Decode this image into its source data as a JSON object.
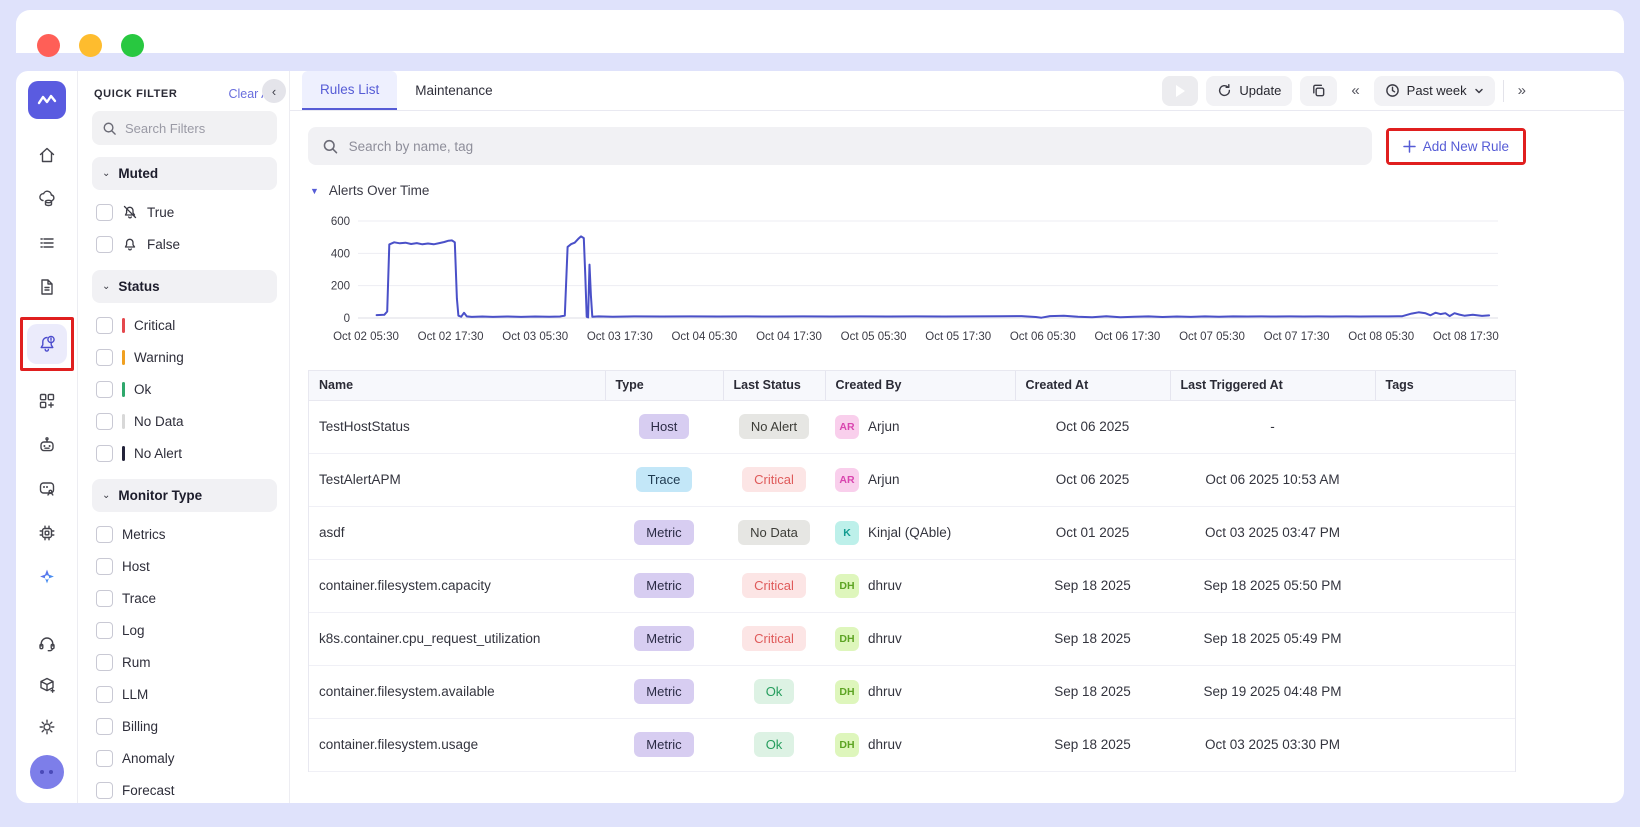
{
  "filter_panel": {
    "title": "QUICK FILTER",
    "clear_all_label": "Clear All",
    "search_placeholder": "Search Filters",
    "sections": [
      {
        "id": "muted",
        "label": "Muted",
        "items": [
          {
            "label": "True",
            "icon": "bell-slash"
          },
          {
            "label": "False",
            "icon": "bell"
          }
        ]
      },
      {
        "id": "status",
        "label": "Status",
        "items": [
          {
            "label": "Critical",
            "bar": "#e5484d"
          },
          {
            "label": "Warning",
            "bar": "#f0a020"
          },
          {
            "label": "Ok",
            "bar": "#2fa86c"
          },
          {
            "label": "No Data",
            "bar": "#d8d8d8"
          },
          {
            "label": "No Alert",
            "bar": "#23233a"
          }
        ]
      },
      {
        "id": "monitor-type",
        "label": "Monitor Type",
        "items": [
          {
            "label": "Metrics"
          },
          {
            "label": "Host"
          },
          {
            "label": "Trace"
          },
          {
            "label": "Log"
          },
          {
            "label": "Rum"
          },
          {
            "label": "LLM"
          },
          {
            "label": "Billing"
          },
          {
            "label": "Anomaly"
          },
          {
            "label": "Forecast"
          }
        ]
      }
    ]
  },
  "tabs": [
    {
      "label": "Rules List",
      "active": true
    },
    {
      "label": "Maintenance",
      "active": false
    }
  ],
  "toolbar": {
    "update_label": "Update",
    "time_range_label": "Past week"
  },
  "search": {
    "placeholder": "Search by name, tag"
  },
  "add_new_rule_label": "Add New Rule",
  "chart_data": {
    "type": "line",
    "title": "Alerts Over Time",
    "line_color": "#4a50c8",
    "ylim": [
      0,
      600
    ],
    "yticks": [
      0,
      200,
      400,
      600
    ],
    "grid": true,
    "x_unit": "hours since Oct 02 05:30",
    "x_tick_interval_hours": 12,
    "x_labels": [
      "Oct 02 05:30",
      "Oct 02 17:30",
      "Oct 03 05:30",
      "Oct 03 17:30",
      "Oct 04 05:30",
      "Oct 04 17:30",
      "Oct 05 05:30",
      "Oct 05 17:30",
      "Oct 06 05:30",
      "Oct 06 17:30",
      "Oct 07 05:30",
      "Oct 07 17:30",
      "Oct 08 05:30",
      "Oct 08 17:30"
    ],
    "series": [
      {
        "name": "alerts",
        "points": [
          [
            1.5,
            18
          ],
          [
            2.6,
            20
          ],
          [
            3.0,
            40
          ],
          [
            3.3,
            455
          ],
          [
            4.0,
            468
          ],
          [
            4.8,
            462
          ],
          [
            5.6,
            466
          ],
          [
            6.4,
            458
          ],
          [
            7.2,
            463
          ],
          [
            8.0,
            456
          ],
          [
            8.8,
            461
          ],
          [
            9.6,
            456
          ],
          [
            10.4,
            463
          ],
          [
            11.1,
            470
          ],
          [
            11.7,
            478
          ],
          [
            12.2,
            480
          ],
          [
            12.6,
            468
          ],
          [
            12.9,
            120
          ],
          [
            13.1,
            14
          ],
          [
            13.5,
            8
          ],
          [
            13.9,
            32
          ],
          [
            14.3,
            10
          ],
          [
            15.0,
            7
          ],
          [
            16.5,
            9
          ],
          [
            18.0,
            7
          ],
          [
            20.0,
            9
          ],
          [
            22.0,
            7
          ],
          [
            24.0,
            9
          ],
          [
            26.0,
            8
          ],
          [
            27.5,
            9
          ],
          [
            28.2,
            15
          ],
          [
            28.6,
            440
          ],
          [
            29.1,
            457
          ],
          [
            29.6,
            466
          ],
          [
            30.1,
            489
          ],
          [
            30.5,
            505
          ],
          [
            30.9,
            494
          ],
          [
            31.1,
            260
          ],
          [
            31.3,
            8
          ],
          [
            31.5,
            4
          ],
          [
            31.7,
            330
          ],
          [
            31.9,
            140
          ],
          [
            32.1,
            8
          ],
          [
            33.0,
            10
          ],
          [
            35.0,
            8
          ],
          [
            38.0,
            10
          ],
          [
            42.0,
            9
          ],
          [
            46.0,
            10
          ],
          [
            50.0,
            9
          ],
          [
            54.0,
            10
          ],
          [
            58.0,
            9
          ],
          [
            62.0,
            10
          ],
          [
            66.0,
            9
          ],
          [
            70.0,
            10
          ],
          [
            74.0,
            9
          ],
          [
            78.0,
            10
          ],
          [
            82.0,
            9
          ],
          [
            86.0,
            10
          ],
          [
            90.0,
            11
          ],
          [
            93.0,
            12
          ],
          [
            95.0,
            6
          ],
          [
            95.8,
            2
          ],
          [
            97.0,
            12
          ],
          [
            99.0,
            14
          ],
          [
            101.0,
            8
          ],
          [
            103.0,
            5
          ],
          [
            105.0,
            11
          ],
          [
            107.0,
            5
          ],
          [
            109.0,
            8
          ],
          [
            111.0,
            10
          ],
          [
            113.0,
            6
          ],
          [
            115.0,
            9
          ],
          [
            117.0,
            7
          ],
          [
            119.0,
            10
          ],
          [
            121.0,
            8
          ],
          [
            123.0,
            10
          ],
          [
            125.0,
            9
          ],
          [
            127.0,
            10
          ],
          [
            129.0,
            9
          ],
          [
            131.0,
            10
          ],
          [
            133.0,
            9
          ],
          [
            135.0,
            10
          ],
          [
            137.0,
            9
          ],
          [
            139.0,
            10
          ],
          [
            141.0,
            9
          ],
          [
            143.0,
            10
          ],
          [
            145.0,
            10
          ],
          [
            147.0,
            11
          ],
          [
            148.3,
            27
          ],
          [
            149.3,
            35
          ],
          [
            150.3,
            29
          ],
          [
            151.0,
            17
          ],
          [
            151.7,
            33
          ],
          [
            152.4,
            24
          ],
          [
            153.1,
            30
          ],
          [
            153.7,
            12
          ],
          [
            154.4,
            30
          ],
          [
            155.1,
            21
          ],
          [
            155.8,
            14
          ],
          [
            157.0,
            20
          ],
          [
            158.3,
            13
          ],
          [
            159.3,
            16
          ]
        ]
      }
    ]
  },
  "table": {
    "columns": [
      "Name",
      "Type",
      "Last Status",
      "Created By",
      "Created At",
      "Last Triggered At",
      "Tags"
    ],
    "rows": [
      {
        "name": "TestHostStatus",
        "type": "Host",
        "type_style": "host",
        "status": "No Alert",
        "status_style": "noalert",
        "avatar": "AR",
        "avatar_style": "pink",
        "created_by": "Arjun",
        "created_at": "Oct 06 2025",
        "last_triggered_at": "-",
        "tags": ""
      },
      {
        "name": "TestAlertAPM",
        "type": "Trace",
        "type_style": "trace",
        "status": "Critical",
        "status_style": "critical",
        "avatar": "AR",
        "avatar_style": "pink",
        "created_by": "Arjun",
        "created_at": "Oct 06 2025",
        "last_triggered_at": "Oct 06 2025 10:53 AM",
        "tags": ""
      },
      {
        "name": "asdf",
        "type": "Metric",
        "type_style": "metric",
        "status": "No Data",
        "status_style": "nodata",
        "avatar": "K",
        "avatar_style": "teal",
        "created_by": "Kinjal (QAble)",
        "created_at": "Oct 01 2025",
        "last_triggered_at": "Oct 03 2025 03:47 PM",
        "tags": ""
      },
      {
        "name": "container.filesystem.capacity",
        "type": "Metric",
        "type_style": "metric",
        "status": "Critical",
        "status_style": "critical",
        "avatar": "DH",
        "avatar_style": "green",
        "created_by": "dhruv",
        "created_at": "Sep 18 2025",
        "last_triggered_at": "Sep 18 2025 05:50 PM",
        "tags": ""
      },
      {
        "name": "k8s.container.cpu_request_utilization",
        "type": "Metric",
        "type_style": "metric",
        "status": "Critical",
        "status_style": "critical",
        "avatar": "DH",
        "avatar_style": "green",
        "created_by": "dhruv",
        "created_at": "Sep 18 2025",
        "last_triggered_at": "Sep 18 2025 05:49 PM",
        "tags": ""
      },
      {
        "name": "container.filesystem.available",
        "type": "Metric",
        "type_style": "metric",
        "status": "Ok",
        "status_style": "ok",
        "avatar": "DH",
        "avatar_style": "green",
        "created_by": "dhruv",
        "created_at": "Sep 18 2025",
        "last_triggered_at": "Sep 19 2025 04:48 PM",
        "tags": ""
      },
      {
        "name": "container.filesystem.usage",
        "type": "Metric",
        "type_style": "metric",
        "status": "Ok",
        "status_style": "ok",
        "avatar": "DH",
        "avatar_style": "green",
        "created_by": "dhruv",
        "created_at": "Sep 18 2025",
        "last_triggered_at": "Oct 03 2025 03:30 PM",
        "tags": ""
      }
    ]
  },
  "colors": {
    "accent": "#565cd6",
    "annotation_red": "#e01f1f",
    "chart_line": "#4a50c8",
    "traffic_red": "#ff5f57",
    "traffic_yellow": "#febc2e",
    "traffic_green": "#28c840"
  }
}
